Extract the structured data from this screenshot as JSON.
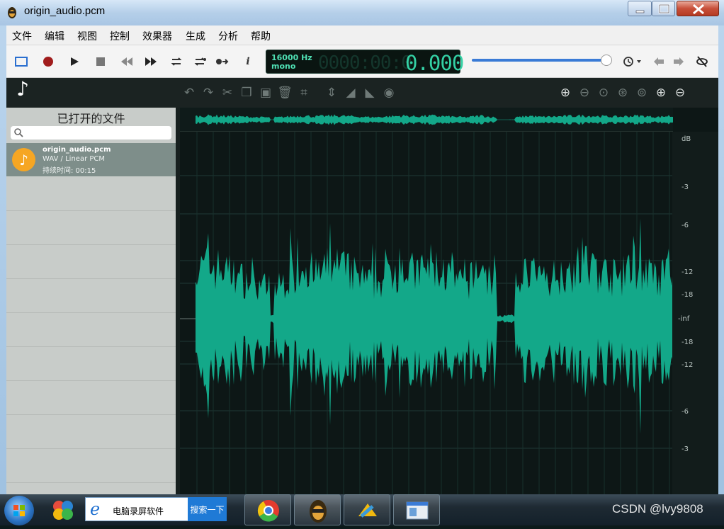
{
  "window": {
    "title": "origin_audio.pcm"
  },
  "menu": [
    "文件",
    "编辑",
    "视图",
    "控制",
    "效果器",
    "生成",
    "分析",
    "帮助"
  ],
  "toolbar": {
    "rate": "16000 Hz",
    "channels": "mono",
    "timecode_dim": "0000:00:0",
    "timecode": "0.000",
    "info_label": "i",
    "position_fraction": 0.97
  },
  "sidebar": {
    "title": "已打开的文件",
    "search_placeholder": "",
    "file": {
      "name": "origin_audio.pcm",
      "format": "WAV / Linear PCM",
      "duration": "持续时间: 00:15"
    }
  },
  "waveform": {
    "color": "#13a889",
    "db_labels": [
      "dB",
      "-3",
      "-6",
      "-12",
      "-18",
      "-inf",
      "-18",
      "-12",
      "-6",
      "-3"
    ]
  },
  "taskbar": {
    "ie_text": "电脑录屏软件",
    "search_button": "搜索一下",
    "watermark": "CSDN @lvy9808"
  },
  "colors": {
    "accent": "#34d1a5",
    "record": "#a01c1c",
    "file_icon": "#f6a623"
  }
}
